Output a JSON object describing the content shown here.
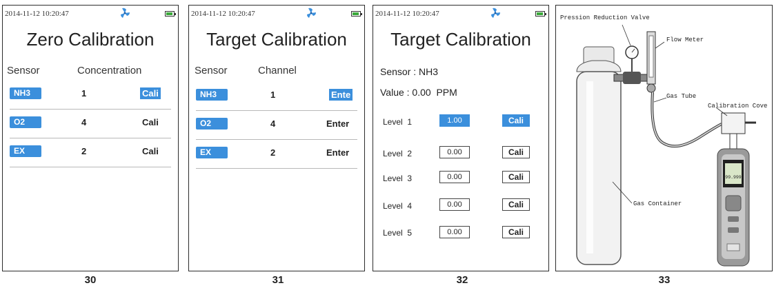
{
  "status": {
    "datetime": "2014-11-12 10:20:47",
    "fan_icon": "fan-icon",
    "battery_icon": "battery-icon"
  },
  "screen30": {
    "title": "Zero Calibration",
    "headers": {
      "sensor": "Sensor",
      "col2": "Concentration"
    },
    "rows": [
      {
        "sensor": "NH3",
        "value": "1",
        "action": "Cali"
      },
      {
        "sensor": "O2",
        "value": "4",
        "action": "Cali"
      },
      {
        "sensor": "EX",
        "value": "2",
        "action": "Cali"
      }
    ],
    "caption": "30"
  },
  "screen31": {
    "title": "Target Calibration",
    "headers": {
      "sensor": "Sensor",
      "col2": "Channel"
    },
    "rows": [
      {
        "sensor": "NH3",
        "value": "1",
        "action": "Ente"
      },
      {
        "sensor": "O2",
        "value": "4",
        "action": "Enter"
      },
      {
        "sensor": "EX",
        "value": "2",
        "action": "Enter"
      }
    ],
    "caption": "31"
  },
  "screen32": {
    "title": "Target Calibration",
    "sensor_line": "Sensor : NH3",
    "value_line": "Value : 0.00  PPM",
    "levels": [
      {
        "label": "Level  1",
        "value": "1.00",
        "action": "Cali"
      },
      {
        "label": "Level  2",
        "value": "0.00",
        "action": "Cali"
      },
      {
        "label": "Level  3",
        "value": "0.00",
        "action": "Cali"
      },
      {
        "label": "Level  4",
        "value": "0.00",
        "action": "Cali"
      },
      {
        "label": "Level  5",
        "value": "0.00",
        "action": "Cali"
      }
    ],
    "caption": "32"
  },
  "screen33": {
    "labels": {
      "valve": "Pression Reduction Valve",
      "flow_meter": "Flow Meter",
      "gas_tube": "Gas Tube",
      "cal_cover": "Calibration Cove",
      "container": "Gas Container"
    },
    "device_reading": "99.999",
    "caption": "33"
  },
  "colors": {
    "accent": "#3b8fdc",
    "battery": "#3aa83a"
  }
}
